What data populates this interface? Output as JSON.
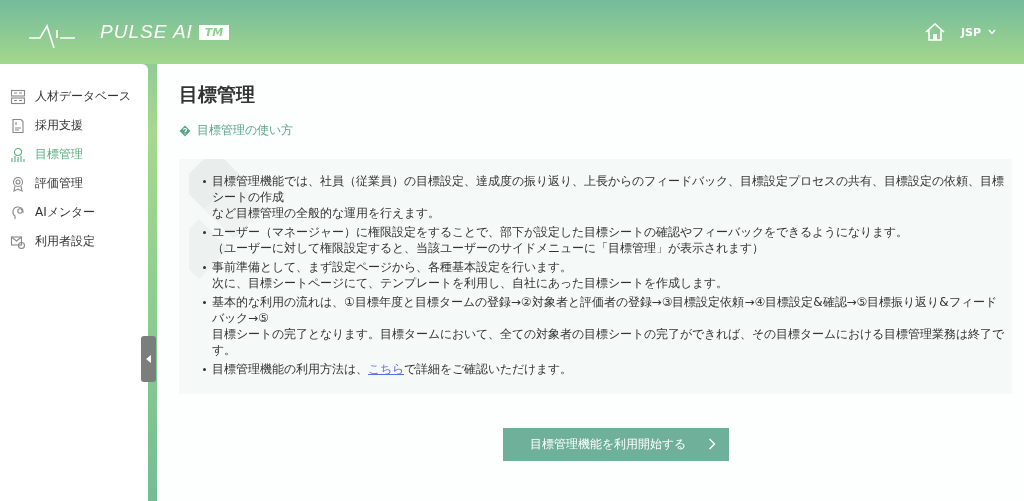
{
  "header": {
    "brand": "PULSE AI",
    "trademark": "TM",
    "user": "JSP"
  },
  "sidebar": {
    "items": [
      {
        "label": "人材データベース",
        "selected": false
      },
      {
        "label": "採用支援",
        "selected": false
      },
      {
        "label": "目標管理",
        "selected": true
      },
      {
        "label": "評価管理",
        "selected": false
      },
      {
        "label": "AIメンター",
        "selected": false
      },
      {
        "label": "利用者設定",
        "selected": false
      }
    ]
  },
  "page": {
    "title": "目標管理",
    "help_link": "目標管理の使い方",
    "bullets": [
      {
        "kind": "text",
        "lines": [
          "目標管理機能では、社員（従業員）の目標設定、達成度の振り返り、上長からのフィードバック、目標設定プロセスの共有、目標設定の依頼、目標シートの作成",
          "など目標管理の全般的な運用を行えます。"
        ]
      },
      {
        "kind": "text",
        "lines": [
          "ユーザー（マネージャー）に権限設定をすることで、部下が設定した目標シートの確認やフィーバックをできるようになります。",
          "（ユーザーに対して権限設定すると、当該ユーザーのサイドメニューに「目標管理」が表示されます）"
        ]
      },
      {
        "kind": "text",
        "lines": [
          "事前準備として、まず設定ページから、各種基本設定を行います。",
          "次に、目標シートページにて、テンプレートを利用し、自社にあった目標シートを作成します。"
        ]
      },
      {
        "kind": "text",
        "lines": [
          "基本的な利用の流れは、①目標年度と目標タームの登録→②対象者と評価者の登録→③目標設定依頼→④目標設定&確認→⑤目標振り返り&フィードバック→⑤",
          "目標シートの完了となります。目標タームにおいて、全ての対象者の目標シートの完了ができれば、その目標タームにおける目標管理業務は終了です。"
        ]
      },
      {
        "kind": "link",
        "before": "目標管理機能の利用方法は、",
        "link": "こちら",
        "after": "で詳細をご確認いただけます。"
      }
    ],
    "start_button": "目標管理機能を利用開始する"
  }
}
